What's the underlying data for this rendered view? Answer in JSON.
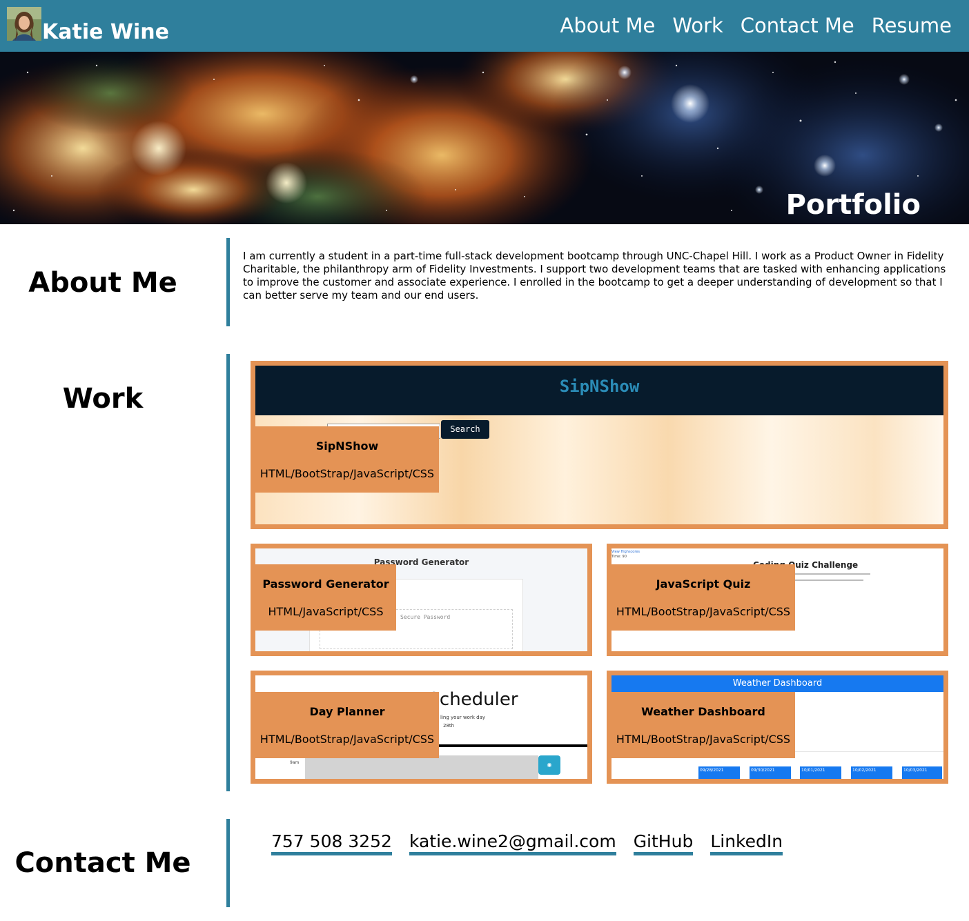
{
  "header": {
    "name": "Katie Wine",
    "nav": [
      "About Me",
      "Work",
      "Contact Me",
      "Resume"
    ]
  },
  "hero": {
    "title": "Portfolio"
  },
  "about": {
    "title": "About Me",
    "text": "I am currently a student in a part-time full-stack development bootcamp through UNC-Chapel Hill. I work as a Product Owner in Fidelity Charitable, the philanthropy arm of Fidelity Investments. I support two development teams that are tasked with enhancing applications to improve the customer and associate experience. I enrolled in the bootcamp to get a deeper understanding of development so that I can better serve my team and our end users."
  },
  "work": {
    "title": "Work",
    "projects": [
      {
        "title": "SipNShow",
        "tech": "HTML/BootStrap/JavaScript/CSS",
        "preview_title": "SipNShow",
        "preview_button": "Search"
      },
      {
        "title": "Password Generator",
        "tech": "HTML/JavaScript/CSS",
        "preview_title": "Password Generator",
        "preview_placeholder": "Secure Password"
      },
      {
        "title": "JavaScript Quiz",
        "tech": "HTML/BootStrap/JavaScript/CSS",
        "preview_title": "Coding Quiz Challenge",
        "preview_link": "View Highscores",
        "preview_time": "Time: 90"
      },
      {
        "title": "Day Planner",
        "tech": "HTML/BootStrap/JavaScript/CSS",
        "preview_title": "Scheduler",
        "preview_sub1": "ling your work day",
        "preview_sub2": "28th",
        "preview_hour": "9am"
      },
      {
        "title": "Weather Dashboard",
        "tech": "HTML/BootStrap/JavaScript/CSS",
        "preview_title": "Weather Dashboard",
        "preview_dates": [
          "09/28/2021",
          "09/30/2021",
          "10/01/2021",
          "10/02/2021",
          "10/03/2021"
        ]
      }
    ]
  },
  "contact": {
    "title": "Contact Me",
    "links": [
      "757 508 3252",
      "katie.wine2@gmail.com",
      "GitHub",
      "LinkedIn"
    ]
  },
  "colors": {
    "header": "#2f7f9c",
    "accent": "#e49355",
    "bar": "#2f7f9c"
  }
}
